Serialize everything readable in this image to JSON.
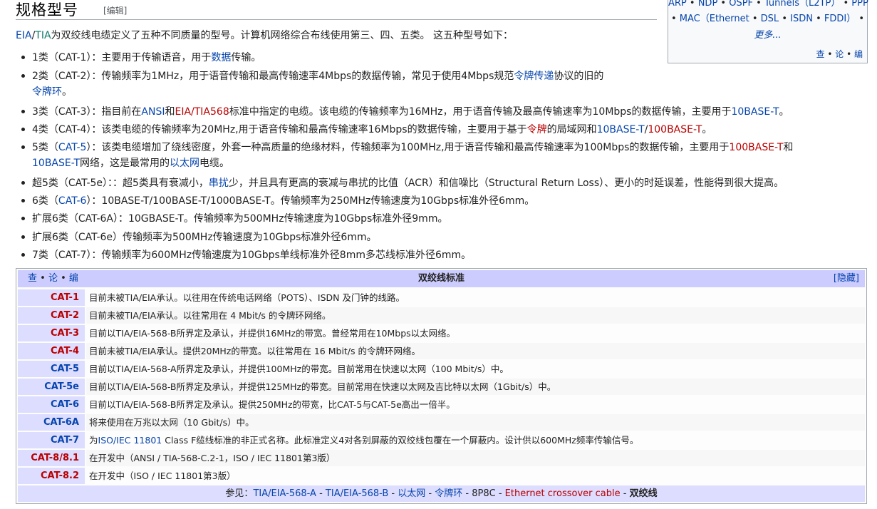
{
  "heading": {
    "title": "规格型号",
    "edit": "[编辑]"
  },
  "infobox": {
    "row1": [
      "ARP",
      "NDP",
      "OSPF",
      "Tunnels（L2TP）",
      "PPP"
    ],
    "row2": [
      "MAC（Ethernet",
      "DSL",
      "ISDN",
      "FDDI）"
    ],
    "sep": " • ",
    "more": "更多...",
    "vte": [
      "查",
      "论",
      "编"
    ]
  },
  "intro": {
    "eia": "EIA",
    "slash": "/",
    "tia": "TIA",
    "rest": "为双绞线电缆定义了五种不同质量的型号。计算机网络综合布线使用第三、四、五类。 这五种型号如下："
  },
  "list": [
    {
      "a": "1类（CAT-1）：主要用于传输语音，用于",
      "l1": "数据",
      "b": "传输。"
    },
    {
      "a": "2类（CAT-2）：传输频率为1MHz，用于语音传输和最高传输速率4Mbps的数据传输，常见于使用4Mbps规范",
      "l1": "令牌传递",
      "b": "协议的旧的",
      "cont": "令牌环",
      "cont2": "。"
    },
    {
      "a": "3类（CAT-3）：指目前在",
      "l1": "ANSI",
      "b": "和",
      "l2": "EIA/TIA568",
      "c": "标准中指定的电缆。该电缆的传输频率为16MHz，用于语音传输及最高传输速率为10Mbps的数据传输，主要用于",
      "l3": "10BASE-T",
      "d": "。"
    },
    {
      "a": "4类（CAT-4）：该类电缆的传输频率为20MHz,用于语音传输和最高传输速率16Mbps的数据传输，主要用于基于",
      "l1": "令牌",
      "b": "的局域网和",
      "l2": "10BASE-T",
      "c": "/",
      "l3": "100BASE-T",
      "d": "。"
    },
    {
      "a": "5类（",
      "l1": "CAT-5",
      "b": "）：该类电缆增加了绕线密度，外套一种高质量的绝缘材料，传输频率为100MHz,用于语音传输和最高传输速率为100Mbps的数据传输，主要用于",
      "l2": "100BASE-T",
      "c": "和",
      "cont_l": "10BASE-T",
      "cont": "网络，这是最常用的",
      "cont_l2": "以太网",
      "cont2": "电缆。"
    },
    {
      "a": "超5类（CAT-5e）：：超5类具有衰减小，",
      "l1": "串扰",
      "b": "少，并且具有更高的衰减与串扰的比值（ACR）和信噪比（Structural Return Loss）、更小的时延误差，性能得到很大提高。"
    },
    {
      "a": "6类（",
      "l1": "CAT-6",
      "b": "）：10BASE-T/100BASE-T/1000BASE-T。传输频率为250MHz传输速度为10Gbps标准外径6mm。"
    },
    {
      "a": "扩展6类（CAT-6A）：10GBASE-T。传输频率为500MHz传输速度为10Gbps标准外径9mm。"
    },
    {
      "a": "扩展6类（CAT-6e）传输频率为500MHz传输速度为10Gbps标准外径6mm。"
    },
    {
      "a": "7类（CAT-7）：传输频率为600MHz传输速度为10Gbps单线标准外径8mm多芯线标准外径6mm。"
    }
  ],
  "navbox": {
    "vte": [
      "查",
      "论",
      "编"
    ],
    "title": "双绞线标准",
    "hide": "[隐藏]",
    "rows": [
      {
        "group": "CAT-1",
        "red": true,
        "text": "目前未被TIA/EIA承认。以往用在传统电话网络（POTS）、ISDN 及门钟的线路。"
      },
      {
        "group": "CAT-2",
        "red": true,
        "text": "目前未被TIA/EIA承认。以往常用在 4 Mbit/s 的令牌环网络。"
      },
      {
        "group": "CAT-3",
        "red": true,
        "text": "目前以TIA/EIA-568-B所界定及承认，并提供16MHz的带宽。曾经常用在10Mbps以太网络。"
      },
      {
        "group": "CAT-4",
        "red": true,
        "text": "目前未被TIA/EIA承认。提供20MHz的带宽。以往常用在 16 Mbit/s 的令牌环网络。"
      },
      {
        "group": "CAT-5",
        "red": false,
        "text": "目前以TIA/EIA-568-A所界定及承认，并提供100MHz的带宽。目前常用在快速以太网（100 Mbit/s）中。"
      },
      {
        "group": "CAT-5e",
        "red": false,
        "text": "目前以TIA/EIA-568-B所界定及承认，并提供125MHz的带宽。目前常用在快速以太网及吉比特以太网（1Gbit/s）中。"
      },
      {
        "group": "CAT-6",
        "red": false,
        "text": "目前以TIA/EIA-568-B所界定及承认。提供250MHz的带宽，比CAT-5与CAT-5e高出一倍半。"
      },
      {
        "group": "CAT-6A",
        "red": false,
        "text": "将来使用在万兆以太网（10 Gbit/s）中。"
      },
      {
        "group": "CAT-7",
        "red": false,
        "text_pre": "为",
        "text_link": "ISO/IEC 11801",
        "text": " Class F缆线标准的非正式名称。此标准定义4对各别屏蔽的双绞线包覆在一个屏蔽内。设计供以600MHz频率传输信号。"
      },
      {
        "group": "CAT-8/8.1",
        "red": true,
        "text": "在开发中（ANSI / TIA-568-C.2-1，ISO / IEC 11801第3版）"
      },
      {
        "group": "CAT-8.2",
        "red": true,
        "text": "在开发中（ISO / IEC 11801第3版）"
      }
    ],
    "footer": {
      "label": "参见：",
      "links": [
        "TIA/EIA-568-A",
        "TIA/EIA-568-B",
        "以太网",
        "令牌环",
        "8P8C",
        "Ethernet crossover cable"
      ],
      "current": "双绞线",
      "sep": " - "
    }
  }
}
